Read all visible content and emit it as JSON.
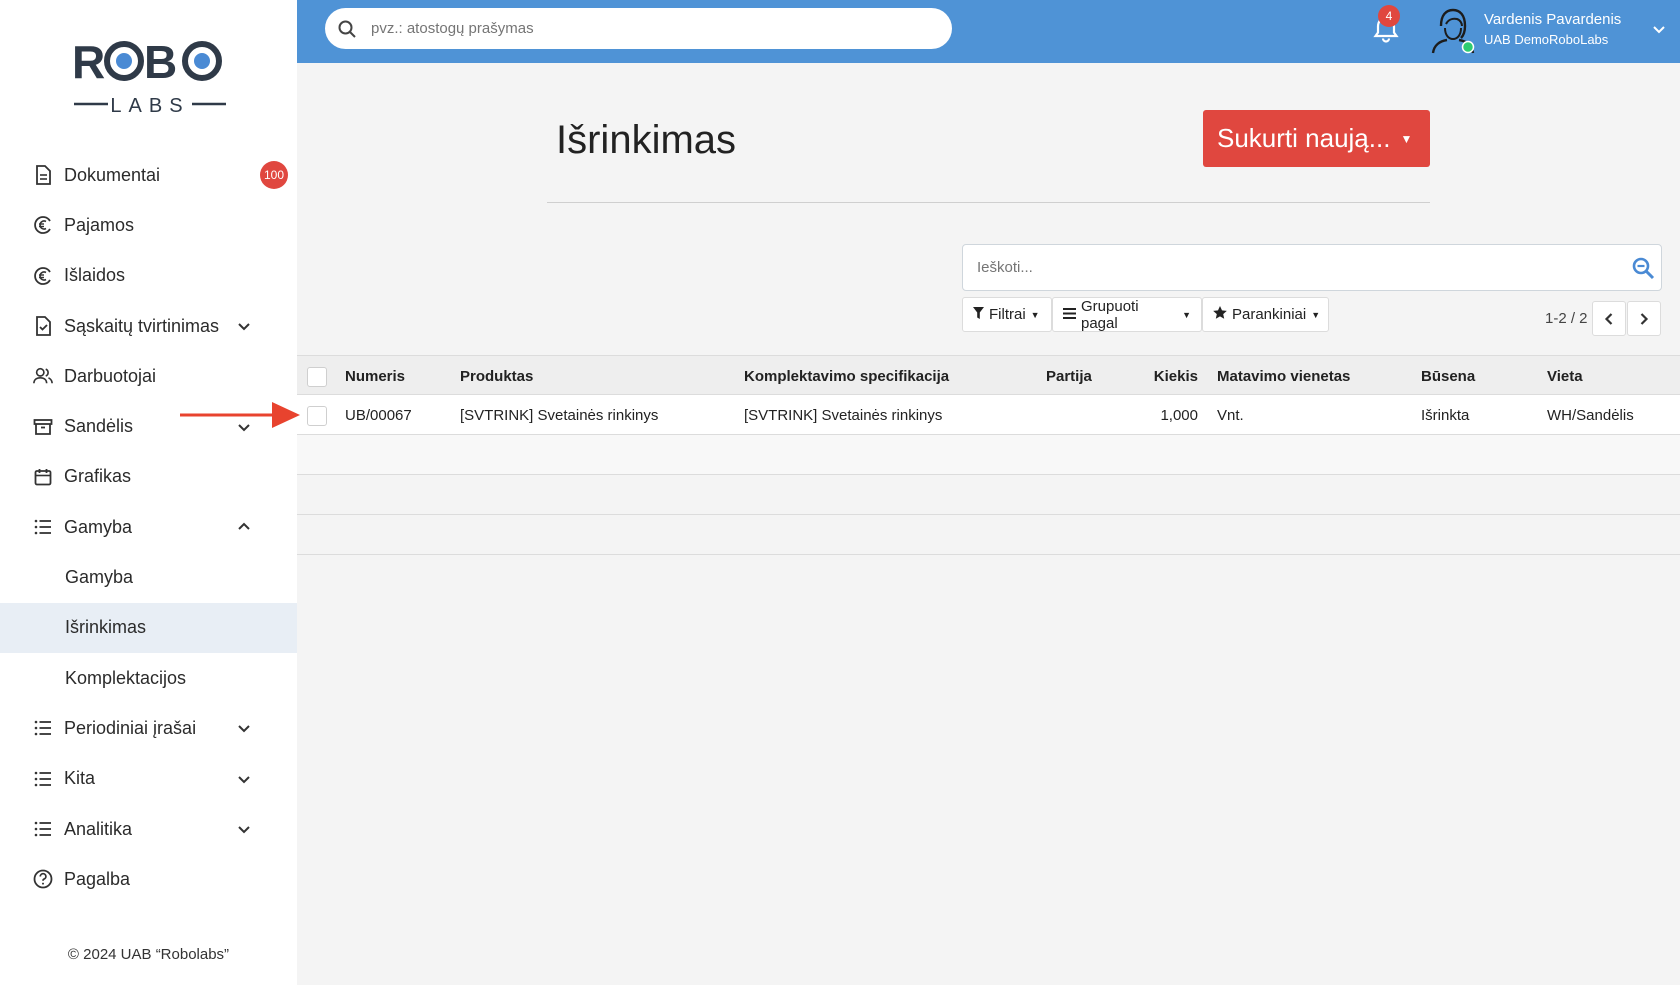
{
  "brand": {
    "logo_top": "ROBO",
    "logo_bottom": "LABS"
  },
  "sidebar": {
    "items": [
      {
        "label": "Dokumentai",
        "icon": "document-icon",
        "badge": "100"
      },
      {
        "label": "Pajamos",
        "icon": "euro-circle-icon"
      },
      {
        "label": "Išlaidos",
        "icon": "euro-circle-icon"
      },
      {
        "label": "Sąskaitų tvirtinimas",
        "icon": "document-check-icon",
        "expand": "chevron-down-icon"
      },
      {
        "label": "Darbuotojai",
        "icon": "users-icon"
      },
      {
        "label": "Sandėlis",
        "icon": "archive-icon",
        "expand": "chevron-down-icon"
      },
      {
        "label": "Grafikas",
        "icon": "calendar-icon"
      },
      {
        "label": "Gamyba",
        "icon": "list-icon",
        "expand": "chevron-up-icon"
      },
      {
        "label": "Gamyba",
        "sub": true
      },
      {
        "label": "Išrinkimas",
        "sub": true,
        "active": true
      },
      {
        "label": "Komplektacijos",
        "sub": true
      },
      {
        "label": "Periodiniai įrašai",
        "icon": "list-icon",
        "expand": "chevron-down-icon"
      },
      {
        "label": "Kita",
        "icon": "list-icon",
        "expand": "chevron-down-icon"
      },
      {
        "label": "Analitika",
        "icon": "list-icon",
        "expand": "chevron-down-icon"
      },
      {
        "label": "Pagalba",
        "icon": "help-circle-icon"
      }
    ],
    "copyright": "© 2024 UAB “Robolabs”"
  },
  "topbar": {
    "search_placeholder": "pvz.: atostogų prašymas",
    "notifications_count": "4",
    "user_name": "Vardenis Pavardenis",
    "user_company": "UAB DemoRoboLabs"
  },
  "page": {
    "title": "Išrinkimas",
    "create_button": "Sukurti naują...",
    "search_placeholder": "Ieškoti...",
    "filters_label": "Filtrai",
    "group_label": "Grupuoti pagal",
    "favorites_label": "Parankiniai",
    "pager": "1-2 / 2"
  },
  "table": {
    "columns": [
      "Numeris",
      "Produktas",
      "Komplektavimo specifikacija",
      "Partija",
      "Kiekis",
      "Matavimo vienetas",
      "Būsena",
      "Vieta"
    ],
    "rows": [
      [
        "UB/00067",
        "[SVTRINK] Svetainės rinkinys",
        "[SVTRINK] Svetainės rinkinys",
        "",
        "1,000",
        "Vnt.",
        "Išrinkta",
        "WH/Sandėlis"
      ]
    ]
  },
  "colors": {
    "topbar": "#4f93d6",
    "accent_red": "#e0473f",
    "active_nav_bg": "#e8eef5"
  }
}
